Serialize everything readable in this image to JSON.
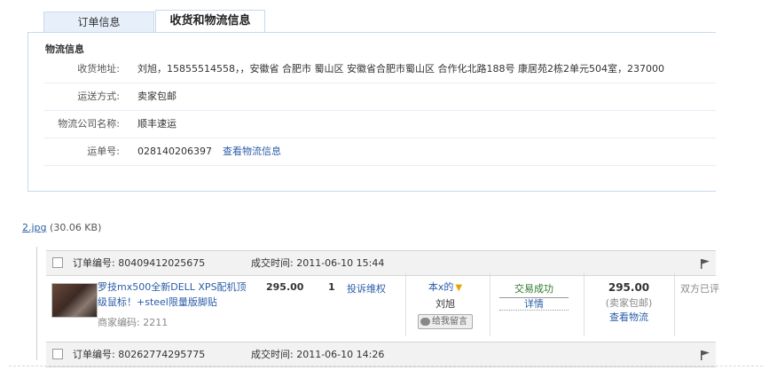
{
  "tabs": [
    "订单信息",
    "收货和物流信息"
  ],
  "logistics": {
    "title": "物流信息",
    "rows": [
      {
        "label": "收货地址:",
        "value": "刘旭，15855514558，，安徽省 合肥市 蜀山区 安徽省合肥市蜀山区 合作化北路188号 康居苑2栋2单元504室，237000"
      },
      {
        "label": "运送方式:",
        "value": "卖家包邮"
      },
      {
        "label": "物流公司名称:",
        "value": "顺丰速运"
      },
      {
        "label": "运单号:",
        "value": "028140206397",
        "link": "查看物流信息"
      }
    ]
  },
  "attachment": {
    "filename": "2.jpg",
    "size": "(30.06 KB)"
  },
  "orders": [
    {
      "order_no_label": "订单编号:",
      "order_no": "80409412025675",
      "time_label": "成交时间:",
      "time": "2011-06-10 15:44",
      "product_name": "罗技mx500全新DELL XPS配机顶级鼠标！+steel限量版脚贴",
      "merchant_code": "商家编码: 2211",
      "price": "295.00",
      "qty": "1",
      "complain": "投诉维权",
      "buyer_self": "本x的",
      "buyer_name": "刘旭",
      "message_btn": "给我留言",
      "status": "交易成功",
      "detail": "详情",
      "total": "295.00",
      "shipping": "(卖家包邮)",
      "view_logistics": "查看物流",
      "rating": "双方已评"
    },
    {
      "order_no_label": "订单编号:",
      "order_no": "80262774295775",
      "time_label": "成交时间:",
      "time": "2011-06-10 14:26"
    }
  ]
}
